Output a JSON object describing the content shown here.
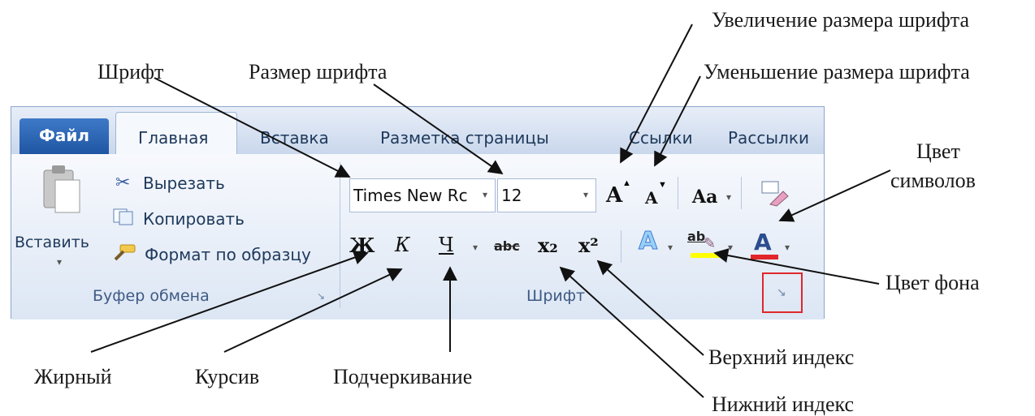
{
  "annotations": {
    "font": "Шрифт",
    "font_size": "Размер шрифта",
    "increase_size": "Увеличение размера шрифта",
    "decrease_size": "Уменьшение размера шрифта",
    "font_color_line1": "Цвет",
    "font_color_line2": "символов",
    "highlight_color": "Цвет фона",
    "superscript": "Верхний индекс",
    "subscript": "Нижний индекс",
    "bold": "Жирный",
    "italic": "Курсив",
    "underline": "Подчеркивание"
  },
  "ribbon": {
    "tabs": [
      "Файл",
      "Главная",
      "Вставка",
      "Разметка страницы",
      "Ссылки",
      "Рассылки"
    ],
    "clipboard": {
      "paste_label": "Вставить",
      "cut_label": "Вырезать",
      "copy_label": "Копировать",
      "format_painter_label": "Формат по образцу",
      "group_label": "Буфер обмена"
    },
    "font_group": {
      "font_name": "Times New Rc",
      "font_size": "12",
      "bold_glyph": "Ж",
      "italic_glyph": "К",
      "underline_glyph": "Ч",
      "strike_glyph": "abc",
      "subscript_glyph": "x₂",
      "superscript_glyph": "x²",
      "grow_glyph": "A",
      "shrink_glyph": "A",
      "case_glyph": "Aa",
      "effects_glyph": "A",
      "highlight_glyph": "ab",
      "font_color_glyph": "A",
      "group_label": "Шрифт"
    }
  },
  "colors": {
    "highlight": "#ffff00",
    "font_color": "#e0262b",
    "launcher_outline": "#e0262b"
  }
}
